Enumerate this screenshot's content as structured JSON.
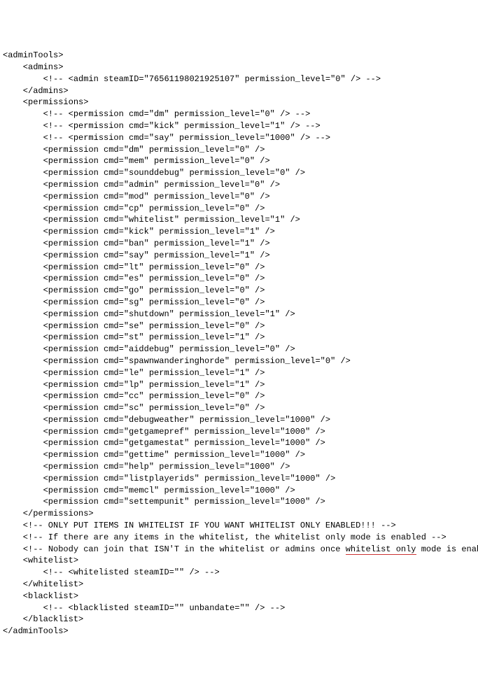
{
  "lines": [
    {
      "text": "<adminTools>",
      "indent": 0
    },
    {
      "text": "<admins>",
      "indent": 1
    },
    {
      "text": "<!-- <admin steamID=\"76561198021925107\" permission_level=\"0\" /> -->",
      "indent": 2
    },
    {
      "text": "</admins>",
      "indent": 1
    },
    {
      "text": "",
      "indent": 0
    },
    {
      "text": "<permissions>",
      "indent": 1
    },
    {
      "text": "<!-- <permission cmd=\"dm\" permission_level=\"0\" /> -->",
      "indent": 2
    },
    {
      "text": "<!-- <permission cmd=\"kick\" permission_level=\"1\" /> -->",
      "indent": 2
    },
    {
      "text": "<!-- <permission cmd=\"say\" permission_level=\"1000\" /> -->",
      "indent": 2
    },
    {
      "text": "<permission cmd=\"dm\" permission_level=\"0\" />",
      "indent": 2
    },
    {
      "text": "<permission cmd=\"mem\" permission_level=\"0\" />",
      "indent": 2
    },
    {
      "text": "<permission cmd=\"sounddebug\" permission_level=\"0\" />",
      "indent": 2
    },
    {
      "text": "<permission cmd=\"admin\" permission_level=\"0\" />",
      "indent": 2
    },
    {
      "text": "<permission cmd=\"mod\" permission_level=\"0\" />",
      "indent": 2
    },
    {
      "text": "<permission cmd=\"cp\" permission_level=\"0\" />",
      "indent": 2
    },
    {
      "text": "<permission cmd=\"whitelist\" permission_level=\"1\" />",
      "indent": 2
    },
    {
      "text": "<permission cmd=\"kick\" permission_level=\"1\" />",
      "indent": 2
    },
    {
      "text": "<permission cmd=\"ban\" permission_level=\"1\" />",
      "indent": 2
    },
    {
      "text": "<permission cmd=\"say\" permission_level=\"1\" />",
      "indent": 2
    },
    {
      "text": "<permission cmd=\"lt\" permission_level=\"0\" />",
      "indent": 2
    },
    {
      "text": "<permission cmd=\"es\" permission_level=\"0\" />",
      "indent": 2
    },
    {
      "text": "<permission cmd=\"go\" permission_level=\"0\" />",
      "indent": 2
    },
    {
      "text": "<permission cmd=\"sg\" permission_level=\"0\" />",
      "indent": 2
    },
    {
      "text": "<permission cmd=\"shutdown\" permission_level=\"1\" />",
      "indent": 2
    },
    {
      "text": "<permission cmd=\"se\" permission_level=\"0\" />",
      "indent": 2
    },
    {
      "text": "<permission cmd=\"st\" permission_level=\"1\" />",
      "indent": 2
    },
    {
      "text": "<permission cmd=\"aiddebug\" permission_level=\"0\" />",
      "indent": 2
    },
    {
      "text": "<permission cmd=\"spawnwanderinghorde\" permission_level=\"0\" />",
      "indent": 2
    },
    {
      "text": "<permission cmd=\"le\" permission_level=\"1\" />",
      "indent": 2
    },
    {
      "text": "<permission cmd=\"lp\" permission_level=\"1\" />",
      "indent": 2
    },
    {
      "text": "<permission cmd=\"cc\" permission_level=\"0\" />",
      "indent": 2
    },
    {
      "text": "<permission cmd=\"sc\" permission_level=\"0\" />",
      "indent": 2
    },
    {
      "text": "<permission cmd=\"debugweather\" permission_level=\"1000\" />",
      "indent": 2
    },
    {
      "text": "<permission cmd=\"getgamepref\" permission_level=\"1000\" />",
      "indent": 2
    },
    {
      "text": "<permission cmd=\"getgamestat\" permission_level=\"1000\" />",
      "indent": 2
    },
    {
      "text": "<permission cmd=\"gettime\" permission_level=\"1000\" />",
      "indent": 2
    },
    {
      "text": "<permission cmd=\"help\" permission_level=\"1000\" />",
      "indent": 2
    },
    {
      "text": "<permission cmd=\"listplayerids\" permission_level=\"1000\" />",
      "indent": 2
    },
    {
      "text": "<permission cmd=\"memcl\" permission_level=\"1000\" />",
      "indent": 2
    },
    {
      "text": "<permission cmd=\"settempunit\" permission_level=\"1000\" />",
      "indent": 2
    },
    {
      "text": "</permissions>",
      "indent": 1
    },
    {
      "text": "",
      "indent": 0
    },
    {
      "text": "<!-- ONLY PUT ITEMS IN WHITELIST IF YOU WANT WHITELIST ONLY ENABLED!!! -->",
      "indent": 1
    },
    {
      "text": "<!-- If there are any items in the whitelist, the whitelist only mode is enabled -->",
      "indent": 1
    },
    {
      "segments": [
        {
          "text": "<!-- Nobody can join that ISN'T in the whitelist or admins once "
        },
        {
          "text": "whitelist only",
          "underline": true
        },
        {
          "text": " mode is enabled -->"
        }
      ],
      "indent": 1
    },
    {
      "text": "",
      "indent": 0
    },
    {
      "text": "<whitelist>",
      "indent": 1
    },
    {
      "text": "<!-- <whitelisted steamID=\"\" /> -->",
      "indent": 2
    },
    {
      "text": "</whitelist>",
      "indent": 1
    },
    {
      "text": "",
      "indent": 0
    },
    {
      "text": "<blacklist>",
      "indent": 1
    },
    {
      "text": "<!-- <blacklisted steamID=\"\" unbandate=\"\" /> -->",
      "indent": 2
    },
    {
      "text": "</blacklist>",
      "indent": 1
    },
    {
      "text": "</adminTools>",
      "indent": 0
    }
  ],
  "indentStr": "    "
}
